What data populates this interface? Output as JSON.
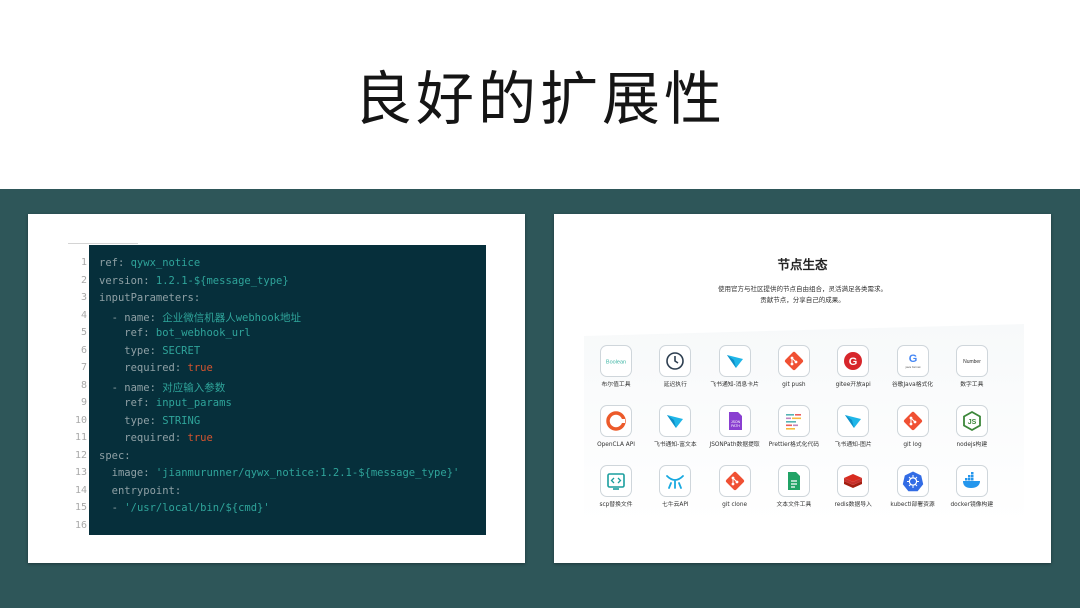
{
  "slide": {
    "title": "良好的扩展性"
  },
  "code": {
    "line_numbers": [
      "1",
      "2",
      "3",
      "4",
      "5",
      "6",
      "7",
      "8",
      "9",
      "10",
      "11",
      "12",
      "13",
      "14",
      "15",
      "16"
    ],
    "lines": [
      [
        {
          "t": "ref: ",
          "c": "k"
        },
        {
          "t": "qywx_notice",
          "c": "v"
        }
      ],
      [
        {
          "t": "version: ",
          "c": "k"
        },
        {
          "t": "1.2.1-${message_type}",
          "c": "v"
        }
      ],
      [
        {
          "t": "inputParameters:",
          "c": "k"
        }
      ],
      [
        {
          "t": "  - name: ",
          "c": "k"
        },
        {
          "t": "企业微信机器人webhook地址",
          "c": "v"
        }
      ],
      [
        {
          "t": "    ref: ",
          "c": "k"
        },
        {
          "t": "bot_webhook_url",
          "c": "v"
        }
      ],
      [
        {
          "t": "    type: ",
          "c": "k"
        },
        {
          "t": "SECRET",
          "c": "v"
        }
      ],
      [
        {
          "t": "    required: ",
          "c": "k"
        },
        {
          "t": "true",
          "c": "b"
        }
      ],
      [
        {
          "t": "  - name: ",
          "c": "k"
        },
        {
          "t": "对应输入参数",
          "c": "v"
        }
      ],
      [
        {
          "t": "    ref: ",
          "c": "k"
        },
        {
          "t": "input_params",
          "c": "v"
        }
      ],
      [
        {
          "t": "    type: ",
          "c": "k"
        },
        {
          "t": "STRING",
          "c": "v"
        }
      ],
      [
        {
          "t": "    required: ",
          "c": "k"
        },
        {
          "t": "true",
          "c": "b"
        }
      ],
      [
        {
          "t": "spec:",
          "c": "k"
        }
      ],
      [
        {
          "t": "  image: ",
          "c": "k"
        },
        {
          "t": "'jianmurunner/qywx_notice:1.2.1-${message_type}'",
          "c": "v"
        }
      ],
      [
        {
          "t": "  entrypoint:",
          "c": "k"
        }
      ],
      [
        {
          "t": "  - ",
          "c": "k"
        },
        {
          "t": "'/usr/local/bin/${cmd}'",
          "c": "v"
        }
      ],
      []
    ]
  },
  "ecosystem": {
    "title": "节点生态",
    "desc_line1": "使用官方与社区提供的节点自由组合，灵活满足各类需求。",
    "desc_line2": "贡献节点，分享自己的成果。",
    "nodes": [
      {
        "label": "布尔值工具",
        "icon": "boolean-icon",
        "color": "#3fb6a5"
      },
      {
        "label": "延迟执行",
        "icon": "clock-icon",
        "color": "#2d3e50"
      },
      {
        "label": "飞书通知-消息卡片",
        "icon": "feishu-icon",
        "color": "#1fb6e8"
      },
      {
        "label": "git push",
        "icon": "git-icon",
        "color": "#f05033"
      },
      {
        "label": "gitee开放api",
        "icon": "gitee-icon",
        "color": "#d7262b"
      },
      {
        "label": "谷歌Java格式化",
        "icon": "google-java-format-icon",
        "color": "#4285f4"
      },
      {
        "label": "数字工具",
        "icon": "number-icon",
        "color": "#333333"
      },
      {
        "label": "OpenCLA API",
        "icon": "opencla-icon",
        "color": "#ec5a2a"
      },
      {
        "label": "飞书通知-富文本",
        "icon": "feishu-icon",
        "color": "#1fb6e8"
      },
      {
        "label": "JSONPath数据提取",
        "icon": "jsonpath-icon",
        "color": "#8a3fd1"
      },
      {
        "label": "Prettier格式化代码",
        "icon": "prettier-icon",
        "color": "#c596c7"
      },
      {
        "label": "飞书通知-图片",
        "icon": "feishu-icon",
        "color": "#1fb6e8"
      },
      {
        "label": "git log",
        "icon": "git-icon",
        "color": "#f05033"
      },
      {
        "label": "nodejs构建",
        "icon": "nodejs-icon",
        "color": "#3c873a"
      },
      {
        "label": "scp替换文件",
        "icon": "scp-icon",
        "color": "#1a9e9e"
      },
      {
        "label": "七牛云API",
        "icon": "qiniu-icon",
        "color": "#18a9e0"
      },
      {
        "label": "git clone",
        "icon": "git-icon",
        "color": "#f05033"
      },
      {
        "label": "文本文件工具",
        "icon": "text-file-icon",
        "color": "#21a366"
      },
      {
        "label": "redis数据导入",
        "icon": "redis-icon",
        "color": "#d82c20"
      },
      {
        "label": "kubectl部署资源",
        "icon": "kubernetes-icon",
        "color": "#326ce5"
      },
      {
        "label": "docker镜像构建",
        "icon": "docker-icon",
        "color": "#2496ed"
      }
    ]
  }
}
